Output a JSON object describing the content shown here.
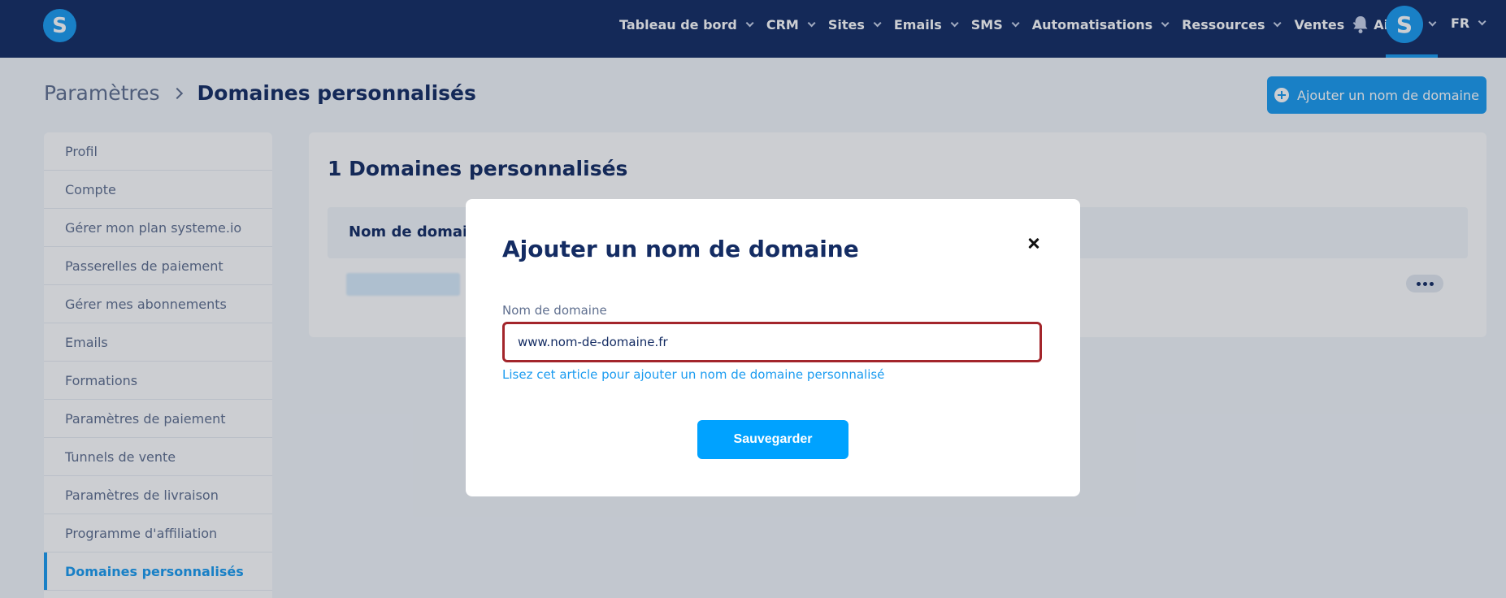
{
  "topbar": {
    "logo_letter": "S",
    "nav_items": [
      {
        "label": "Tableau de bord",
        "has_chevron": true
      },
      {
        "label": "CRM",
        "has_chevron": true
      },
      {
        "label": "Sites",
        "has_chevron": true
      },
      {
        "label": "Emails",
        "has_chevron": true
      },
      {
        "label": "SMS",
        "has_chevron": true
      },
      {
        "label": "Automatisations",
        "has_chevron": true
      },
      {
        "label": "Ressources",
        "has_chevron": true
      },
      {
        "label": "Ventes",
        "has_chevron": true
      },
      {
        "label": "Aide",
        "has_chevron": false
      }
    ],
    "bell_icon": "bell-icon",
    "avatar_letter": "S",
    "language": "FR"
  },
  "header": {
    "breadcrumb_parent": "Paramètres",
    "breadcrumb_current": "Domaines personnalisés",
    "add_button_label": "Ajouter un nom de domaine"
  },
  "sidebar": {
    "items": [
      {
        "label": "Profil"
      },
      {
        "label": "Compte"
      },
      {
        "label": "Gérer mon plan systeme.io"
      },
      {
        "label": "Passerelles de paiement"
      },
      {
        "label": "Gérer mes abonnements"
      },
      {
        "label": "Emails"
      },
      {
        "label": "Formations"
      },
      {
        "label": "Paramètres de paiement"
      },
      {
        "label": "Tunnels de vente"
      },
      {
        "label": "Paramètres de livraison"
      },
      {
        "label": "Programme d'affiliation"
      },
      {
        "label": "Domaines personnalisés",
        "active": true
      }
    ]
  },
  "main": {
    "card_title": "1 Domaines personnalisés",
    "table_header_first_col": "Nom de domaine"
  },
  "modal": {
    "title": "Ajouter un nom de domaine",
    "field_label": "Nom de domaine",
    "field_value": "www.nom-de-domaine.fr",
    "help_link": "Lisez cet article pour ajouter un nom de domaine personnalisé",
    "save_label": "Sauvegarder"
  },
  "colors": {
    "nav_bg": "#142c63",
    "accent": "#1a9bf0",
    "input_border_highlight": "#a3252b",
    "text_dark": "#142c63"
  }
}
